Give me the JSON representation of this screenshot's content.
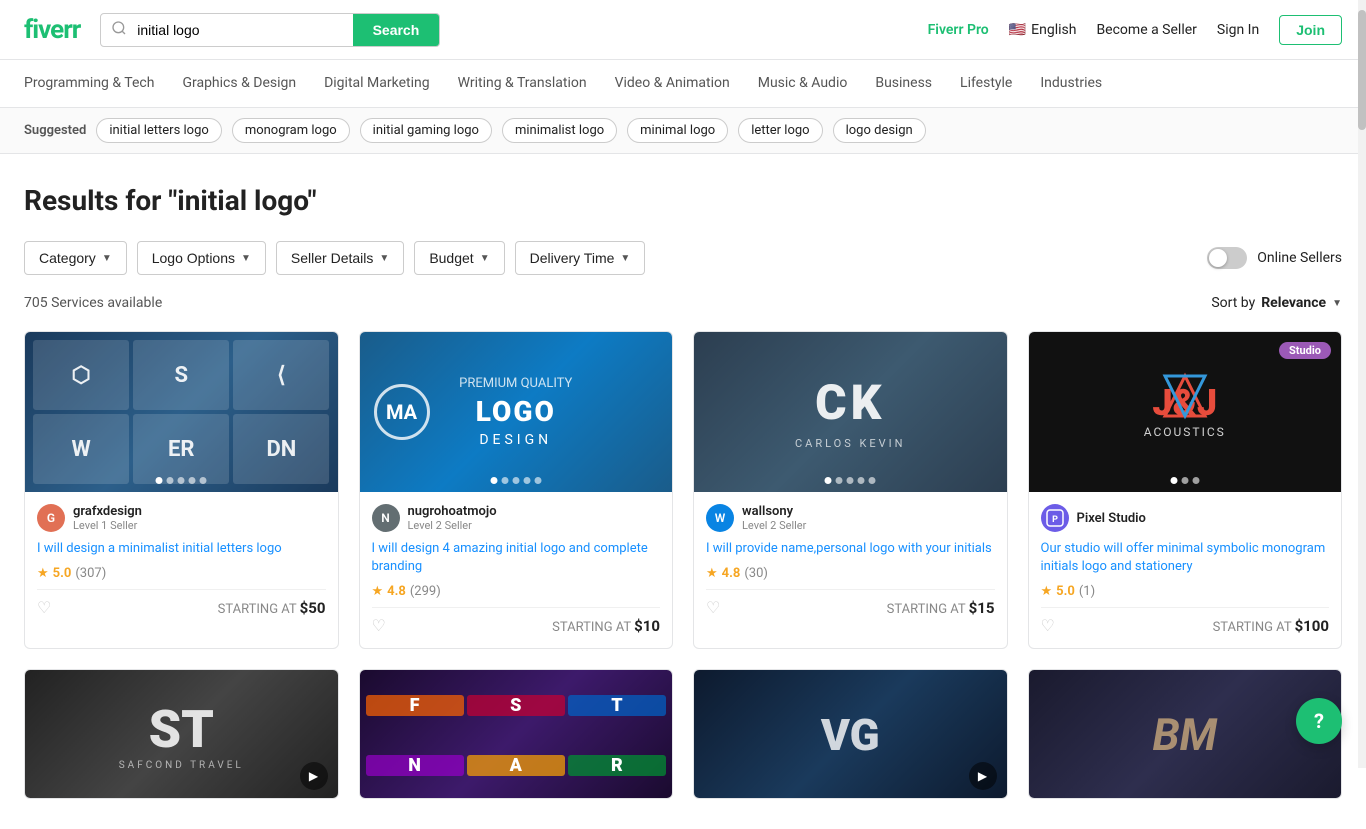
{
  "header": {
    "logo": "fiverr",
    "search_placeholder": "initial logo",
    "search_btn": "Search",
    "fiverr_pro": "Fiverr Pro",
    "language": "English",
    "become_seller": "Become a Seller",
    "sign_in": "Sign In",
    "join": "Join"
  },
  "nav": {
    "items": [
      "Programming & Tech",
      "Graphics & Design",
      "Digital Marketing",
      "Writing & Translation",
      "Video & Animation",
      "Music & Audio",
      "Business",
      "Lifestyle",
      "Industries"
    ]
  },
  "suggested": {
    "label": "Suggested",
    "tags": [
      "initial letters logo",
      "monogram logo",
      "initial gaming logo",
      "minimalist logo",
      "minimal logo",
      "letter logo",
      "logo design"
    ]
  },
  "results": {
    "title": "Results for \"initial logo\"",
    "count": "705 Services available",
    "sort_label": "Sort by",
    "sort_value": "Relevance"
  },
  "filters": [
    {
      "label": "Category",
      "id": "category-filter"
    },
    {
      "label": "Logo Options",
      "id": "logo-options-filter"
    },
    {
      "label": "Seller Details",
      "id": "seller-details-filter"
    },
    {
      "label": "Budget",
      "id": "budget-filter"
    },
    {
      "label": "Delivery Time",
      "id": "delivery-time-filter"
    }
  ],
  "online_sellers": "Online Sellers",
  "cards": [
    {
      "id": "card-1",
      "seller_name": "grafxdesign",
      "seller_level": "Level 1 Seller",
      "title": "I will design a minimalist initial letters logo",
      "rating": "5.0",
      "reviews": "307",
      "starting_at": "STARTING AT",
      "price": "$50",
      "avatar_color": "#e17055",
      "avatar_letter": "G",
      "img_class": "img-1",
      "has_dots": true,
      "dot_count": 5,
      "active_dot": 1
    },
    {
      "id": "card-2",
      "seller_name": "nugrohoatmojo",
      "seller_level": "Level 2 Seller",
      "title": "I will design 4 amazing initial logo and complete branding",
      "rating": "4.8",
      "reviews": "299",
      "starting_at": "STARTING AT",
      "price": "$10",
      "avatar_color": "#636e72",
      "avatar_letter": "N",
      "img_class": "img-2",
      "has_dots": true,
      "dot_count": 5,
      "active_dot": 0
    },
    {
      "id": "card-3",
      "seller_name": "wallsony",
      "seller_level": "Level 2 Seller",
      "title": "I will provide name,personal logo with your initials",
      "rating": "4.8",
      "reviews": "30",
      "starting_at": "STARTING AT",
      "price": "$15",
      "avatar_color": "#0984e3",
      "avatar_letter": "W",
      "img_class": "img-3",
      "has_dots": true,
      "dot_count": 5,
      "active_dot": 0,
      "center_text": "CaRLOS KEvIn"
    },
    {
      "id": "card-4",
      "seller_name": "Pixel Studio",
      "seller_level": "",
      "title": "Our studio will offer minimal symbolic monogram initials logo and stationery",
      "rating": "5.0",
      "reviews": "1",
      "starting_at": "STARTING AT",
      "price": "$100",
      "avatar_color": "#6c5ce7",
      "avatar_letter": "P",
      "img_class": "img-4",
      "has_dots": true,
      "dot_count": 3,
      "active_dot": 0,
      "badge": "Studio",
      "is_studio": true
    },
    {
      "id": "card-5",
      "seller_name": "",
      "seller_level": "",
      "title": "",
      "rating": "",
      "reviews": "",
      "starting_at": "",
      "price": "",
      "img_class": "img-5",
      "has_play": true,
      "partial": true
    },
    {
      "id": "card-6",
      "seller_name": "",
      "seller_level": "",
      "title": "",
      "rating": "",
      "reviews": "",
      "starting_at": "",
      "price": "",
      "img_class": "img-6",
      "partial": true
    },
    {
      "id": "card-7",
      "seller_name": "",
      "seller_level": "",
      "title": "",
      "rating": "",
      "reviews": "",
      "starting_at": "",
      "price": "",
      "img_class": "img-7",
      "has_play": true,
      "partial": true
    },
    {
      "id": "card-8",
      "seller_name": "",
      "seller_level": "",
      "title": "",
      "rating": "",
      "reviews": "",
      "starting_at": "",
      "price": "",
      "img_class": "img-8",
      "partial": true
    }
  ],
  "help_btn": "?",
  "scrollbar": {}
}
